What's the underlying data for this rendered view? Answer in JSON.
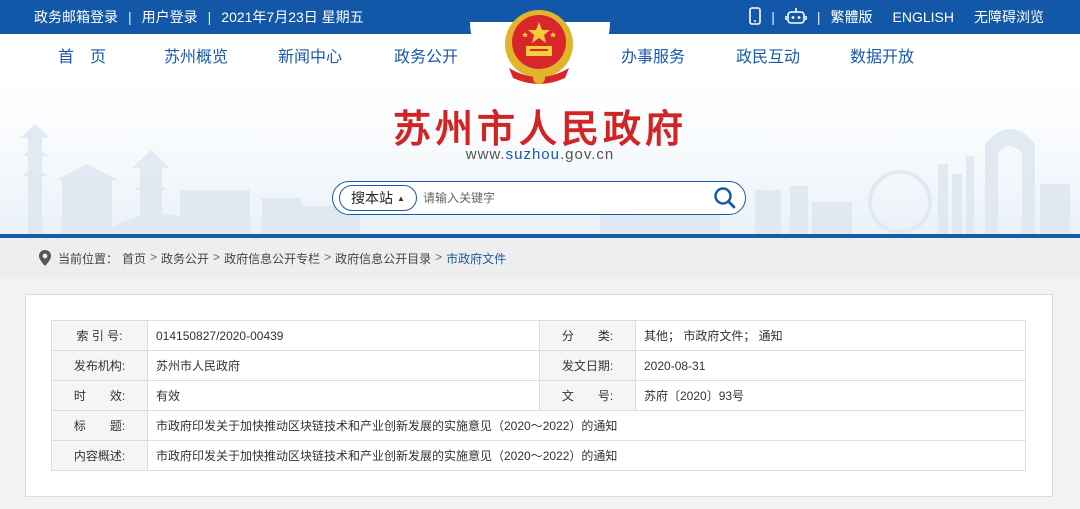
{
  "topbar": {
    "mail_login": "政务邮箱登录",
    "user_login": "用户登录",
    "date": "2021年7月23日 星期五",
    "traditional": "繁體版",
    "english": "ENGLISH",
    "accessible": "无障碍浏览",
    "sep": "|"
  },
  "nav": {
    "items": [
      "首　页",
      "苏州概览",
      "新闻中心",
      "政务公开",
      "办事服务",
      "政民互动",
      "数据开放"
    ]
  },
  "header": {
    "title": "苏州市人民政府",
    "url_prefix": "www.",
    "url_highlight": "suzhou",
    "url_suffix": ".gov.cn"
  },
  "search": {
    "scope": "搜本站",
    "placeholder": "请输入关键字"
  },
  "breadcrumb": {
    "label": "当前位置：",
    "items": [
      "首页",
      "政务公开",
      "政府信息公开专栏",
      "政府信息公开目录",
      "市政府文件"
    ],
    "arrow": ">"
  },
  "meta": {
    "rows": [
      {
        "l1": "索 引 号:",
        "v1": "014150827/2020-00439",
        "l2": "分　　类:",
        "v2": "其他；  市政府文件；  通知"
      },
      {
        "l1": "发布机构:",
        "v1": "苏州市人民政府",
        "l2": "发文日期:",
        "v2": "2020-08-31"
      },
      {
        "l1": "时　　效:",
        "v1": "有效",
        "l2": "文　　号:",
        "v2": "苏府〔2020〕93号"
      }
    ],
    "title_label": "标　　题:",
    "title_value": "市政府印发关于加快推动区块链技术和产业创新发展的实施意见（2020～2022）的通知",
    "summary_label": "内容概述:",
    "summary_value": "市政府印发关于加快推动区块链技术和产业创新发展的实施意见（2020～2022）的通知"
  },
  "colors": {
    "brand_blue": "#1358a8",
    "title_red": "#d22424"
  }
}
